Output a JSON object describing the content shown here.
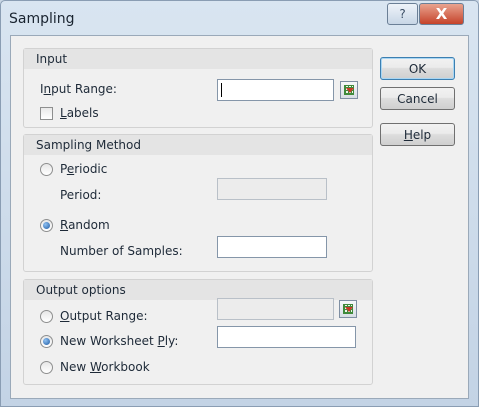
{
  "window": {
    "title": "Sampling",
    "help_glyph": "?",
    "close_glyph": "X"
  },
  "input": {
    "group_title": "Input",
    "input_range_label": "Input Range:",
    "input_range_value": "",
    "labels_label": "Labels",
    "labels_checked": false
  },
  "sampling_method": {
    "group_title": "Sampling Method",
    "periodic_label": "Periodic",
    "period_label": "Period:",
    "period_value": "",
    "random_label": "Random",
    "samples_label": "Number of Samples:",
    "samples_value": "",
    "selected": "Random"
  },
  "output": {
    "group_title": "Output options",
    "output_range_label": "Output Range:",
    "output_range_value": "",
    "new_ply_label": "New Worksheet Ply:",
    "new_ply_value": "",
    "new_workbook_label": "New Workbook",
    "selected": "New Worksheet Ply"
  },
  "buttons": {
    "ok": "OK",
    "cancel": "Cancel",
    "help": "Help"
  },
  "icons": {
    "refedit": "range-select-icon",
    "help": "question-icon",
    "close": "close-icon"
  },
  "colors": {
    "title_bg": "#d9e5f1",
    "close_button": "#c5432a",
    "dialog_bg": "#f0f0f0",
    "default_button_border": "#3c7fb1"
  }
}
